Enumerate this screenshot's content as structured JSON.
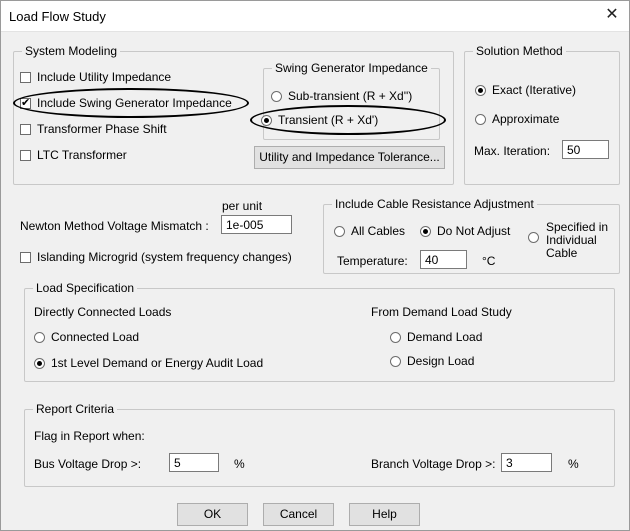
{
  "window": {
    "title": "Load Flow Study"
  },
  "system_modeling": {
    "label": "System Modeling",
    "include_utility_impedance": "Include Utility  Impedance",
    "include_swing_generator_impedance": "Include Swing Generator Impedance",
    "transformer_phase_shift": "Transformer Phase Shift",
    "ltc_transformer": "LTC Transformer",
    "swing_generator_impedance": {
      "label": "Swing Generator Impedance",
      "subtransient": "Sub-transient (R + Xd'')",
      "transient": "Transient  (R + Xd')"
    },
    "tolerance_button": "Utility and Impedance Tolerance..."
  },
  "solution_method": {
    "label": "Solution Method",
    "exact": "Exact (Iterative)",
    "approximate": "Approximate",
    "max_iteration_label": "Max. Iteration:",
    "max_iteration_value": "50"
  },
  "newton": {
    "per_unit": "per unit",
    "mismatch_label": "Newton Method Voltage Mismatch :",
    "mismatch_value": "1e-005",
    "islanding": "Islanding Microgrid (system frequency changes)"
  },
  "cable_resistance": {
    "label": "Include Cable Resistance Adjustment",
    "all_cables": "All Cables",
    "do_not_adjust": "Do Not Adjust",
    "specified_line1": "Specified in",
    "specified_line2": "Individual",
    "specified_line3": "Cable",
    "temperature_label": "Temperature:",
    "temperature_value": "40",
    "temperature_unit": "°C"
  },
  "load_specification": {
    "label": "Load  Specification",
    "directly_connected": "Directly Connected Loads",
    "connected_load": "Connected Load",
    "first_level_demand": "1st Level Demand or Energy Audit Load",
    "from_demand_study": "From Demand Load  Study",
    "demand_load": "Demand Load",
    "design_load": "Design Load"
  },
  "report_criteria": {
    "label": "Report Criteria",
    "flag_label": "Flag in Report when:",
    "bus_voltage_drop_label": "Bus Voltage Drop >:",
    "bus_voltage_drop_value": "5",
    "branch_voltage_drop_label": "Branch Voltage Drop >:",
    "branch_voltage_drop_value": "3",
    "percent": "%"
  },
  "buttons": {
    "ok": "OK",
    "cancel": "Cancel",
    "help": "Help"
  }
}
